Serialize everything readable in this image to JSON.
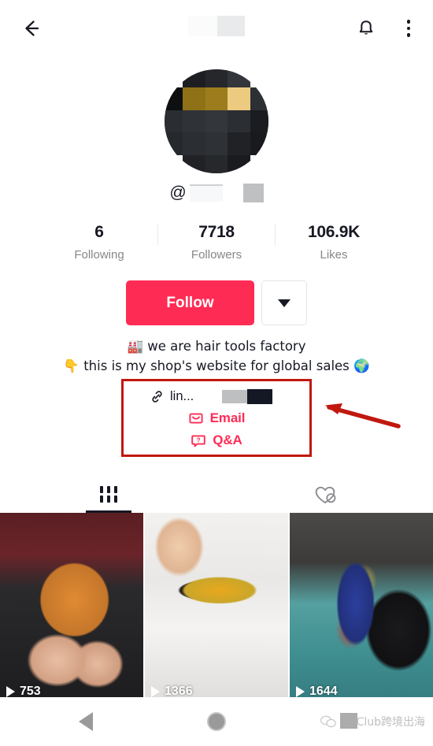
{
  "topbar": {
    "back_icon": "arrow-left-icon",
    "title_redacted": true,
    "notification_icon": "bell-icon",
    "more_icon": "more-vertical-icon"
  },
  "profile": {
    "avatar": {
      "state": "pixelated-censored",
      "mosaic_colors": [
        "#ffffff",
        "#1d1e21",
        "#26272b",
        "#33363a",
        "#ffffff",
        "#0e0f11",
        "#8f7118",
        "#9c7c1c",
        "#ecca80",
        "#2c2f33",
        "#2a2d31",
        "#2f3237",
        "#33363b",
        "#2b2e33",
        "#1b1c1f",
        "#25282c",
        "#2b2e32",
        "#2e3135",
        "#202225",
        "#191a1d",
        "#ffffff",
        "#212225",
        "#26282b",
        "#1a1b1e",
        "#ffffff"
      ]
    },
    "handle_prefix": "@",
    "handle_redacted": true,
    "stats": [
      {
        "value": "6",
        "label": "Following",
        "name": "following"
      },
      {
        "value": "7718",
        "label": "Followers",
        "name": "followers"
      },
      {
        "value": "106.9K",
        "label": "Likes",
        "name": "likes"
      }
    ],
    "follow_label": "Follow",
    "follow_dropdown_icon": "chevron-down-icon",
    "bio": {
      "line1": "🏭 we are hair tools factory",
      "line2": "👇 this is my shop's website for global sales 🌍"
    },
    "links": {
      "website": {
        "icon": "link-icon",
        "text": "lin...",
        "redacted": true
      },
      "email": {
        "icon": "envelope-icon",
        "label": "Email"
      },
      "qa": {
        "icon": "question-bubble-icon",
        "label": "Q&A"
      }
    }
  },
  "annotation": {
    "box_color": "#c0180f",
    "arrow_color": "#c0180f",
    "arrow_direction": "left"
  },
  "tabs": [
    {
      "name": "tab-videos",
      "icon": "grid-icon",
      "active": true
    },
    {
      "name": "tab-liked",
      "icon": "heart-slash-icon",
      "active": false
    }
  ],
  "videos": [
    {
      "views": "753",
      "play_icon": "play-icon",
      "name": "video-thumbnail-1"
    },
    {
      "views": "1366",
      "play_icon": "play-icon",
      "name": "video-thumbnail-2"
    },
    {
      "views": "1644",
      "play_icon": "play-icon",
      "name": "video-thumbnail-3"
    }
  ],
  "navbar": {
    "back_icon": "nav-back-triangle-icon",
    "home_icon": "nav-home-circle-icon",
    "watermark_text": "TikClub跨境出海",
    "watermark_icon": "wechat-icon"
  },
  "colors": {
    "accent": "#fe2c55",
    "text": "#161823",
    "muted": "#86878b",
    "annotation": "#c0180f"
  }
}
